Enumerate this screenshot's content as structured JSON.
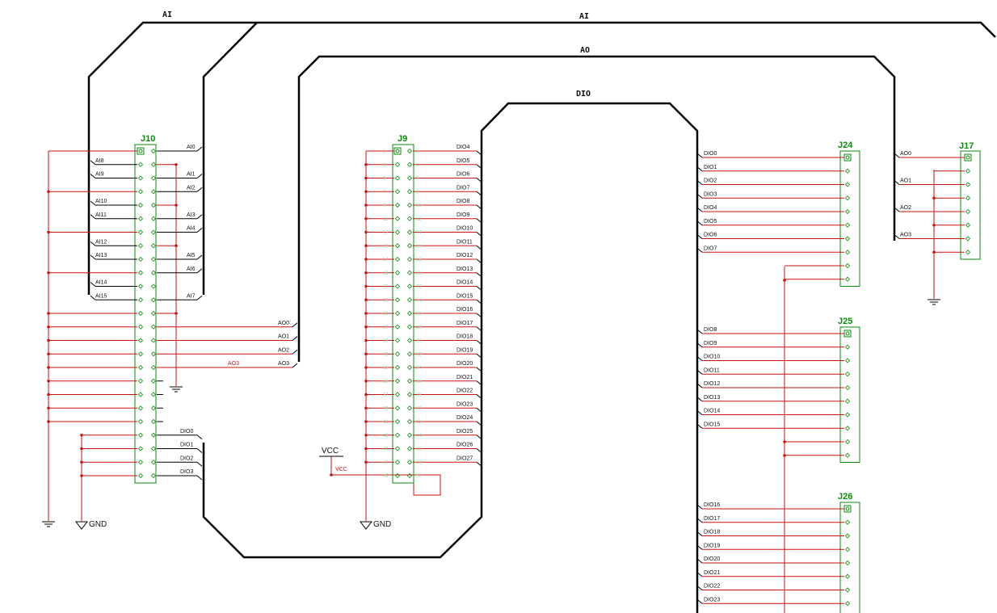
{
  "buses": {
    "ai": "AI",
    "ao": "AO",
    "dio": "DIO"
  },
  "colors": {
    "bus": "#000000",
    "wire": "#cc1111",
    "component": "#0a8a0a",
    "junction": "#cc1111"
  },
  "connectors": {
    "j10": {
      "ref": "J10",
      "left_labels": [
        "AI8",
        "AI9",
        "AI10",
        "AI11",
        "AI12",
        "AI13",
        "AI14",
        "AI15"
      ],
      "right_labels": [
        "AI0",
        "AI1",
        "AI2",
        "AI3",
        "AI4",
        "AI5",
        "AI6",
        "AI7"
      ],
      "ao_labels": [
        "AO0",
        "AO1",
        "AO2",
        "AO3"
      ],
      "ao_red_label": "AO3",
      "dio_labels": [
        "DIO0",
        "DIO1",
        "DIO2",
        "DIO3"
      ]
    },
    "j9": {
      "ref": "J9",
      "right_labels": [
        "DIO4",
        "DIO5",
        "DIO6",
        "DIO7",
        "DIO8",
        "DIO9",
        "DIO10",
        "DIO11",
        "DIO12",
        "DIO13",
        "DIO14",
        "DIO15",
        "DIO16",
        "DIO17",
        "DIO18",
        "DIO19",
        "DIO20",
        "DIO21",
        "DIO22",
        "DIO23",
        "DIO24",
        "DIO25",
        "DIO26",
        "DIO27"
      ],
      "pin_numbers_left": [
        "1",
        "3",
        "5",
        "7",
        "9",
        "11",
        "13",
        "15",
        "17",
        "19",
        "21",
        "23",
        "25",
        "27",
        "29",
        "31",
        "33",
        "35",
        "37",
        "39",
        "41",
        "43",
        "45",
        "47",
        "49"
      ],
      "pin_numbers_right": [
        "2",
        "4",
        "6",
        "8",
        "10",
        "12",
        "14",
        "16",
        "18",
        "20",
        "22",
        "24",
        "26",
        "28",
        "30",
        "32",
        "34",
        "36",
        "38",
        "40",
        "42",
        "44",
        "46",
        "48",
        "50"
      ]
    },
    "j24": {
      "ref": "J24",
      "labels": [
        "DIO0",
        "DIO1",
        "DIO2",
        "DIO3",
        "DIO4",
        "DIO5",
        "DIO6",
        "DIO7"
      ]
    },
    "j25": {
      "ref": "J25",
      "labels": [
        "DIO8",
        "DIO9",
        "DIO10",
        "DIO11",
        "DIO12",
        "DIO13",
        "DIO14",
        "DIO15"
      ]
    },
    "j26": {
      "ref": "J26",
      "labels": [
        "DIO16",
        "DIO17",
        "DIO18",
        "DIO19",
        "DIO20",
        "DIO21",
        "DIO22",
        "DIO23"
      ]
    },
    "j17": {
      "ref": "J17",
      "labels": [
        "AO0",
        "AO1",
        "AO2",
        "AO3"
      ]
    }
  },
  "power": {
    "vcc": "VCC",
    "vcc_red": "VCC",
    "gnd_left": "GND",
    "gnd_mid": "GND"
  }
}
